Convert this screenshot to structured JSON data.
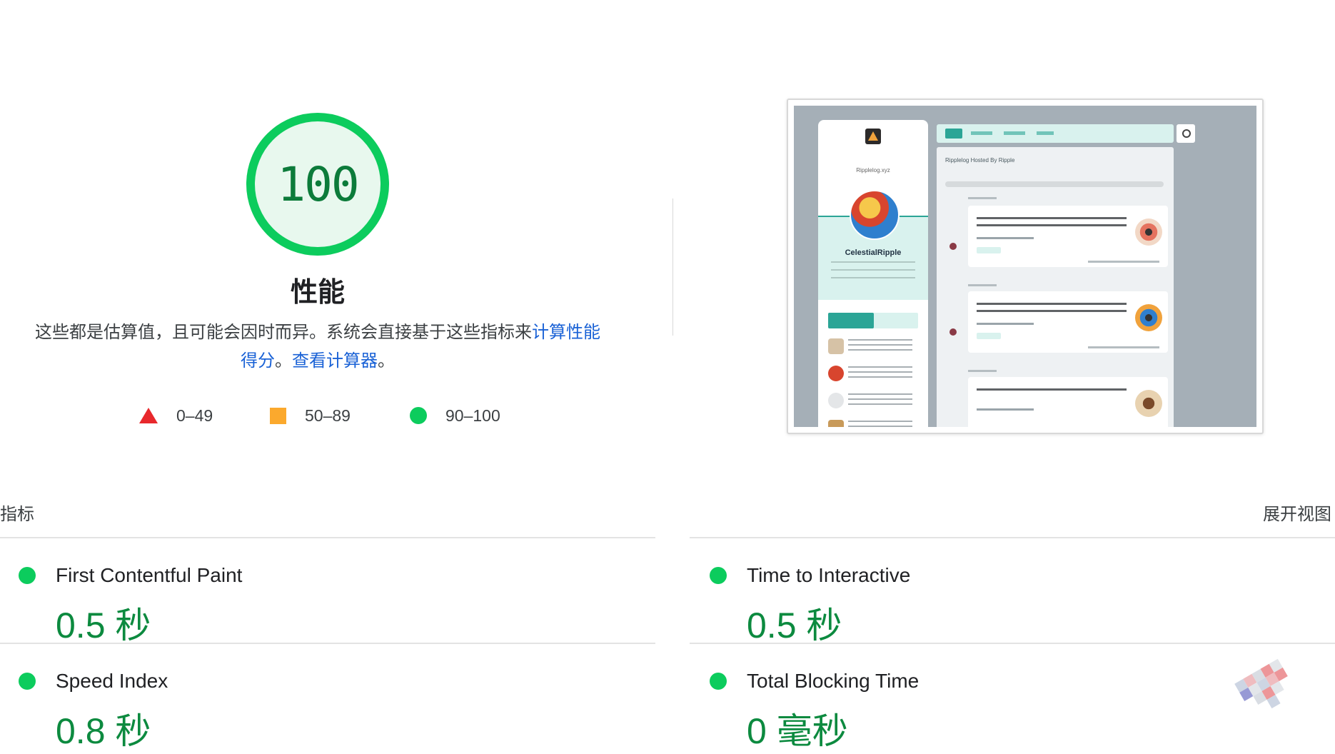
{
  "score": {
    "value": 100,
    "fraction": 1.0,
    "title": "性能",
    "description_prefix": "这些都是估算值，且可能会因时而异。系统会直接基于这些指标来",
    "description_link1": "计算性能得分",
    "description_mid": "。",
    "description_link2": "查看计算器",
    "description_suffix": "。"
  },
  "legend": {
    "fail": "0–49",
    "average": "50–89",
    "pass": "90–100"
  },
  "thumbnail": {
    "site_name": "Ripplelog.xyz",
    "user_name": "CelestialRipple",
    "main_title": "Ripplelog Hosted By Ripple"
  },
  "metrics": {
    "header": "指标",
    "expand": "展开视图",
    "items": [
      {
        "title": "First Contentful Paint",
        "value": "0.5 秒"
      },
      {
        "title": "Time to Interactive",
        "value": "0.5 秒"
      },
      {
        "title": "Speed Index",
        "value": "0.8 秒"
      },
      {
        "title": "Total Blocking Time",
        "value": "0 毫秒"
      }
    ]
  },
  "colors": {
    "pass": "#0ccc5d",
    "pass_text": "#0c8a3f",
    "average": "#fba92d",
    "fail": "#e8282c",
    "link": "#1a62d6"
  }
}
